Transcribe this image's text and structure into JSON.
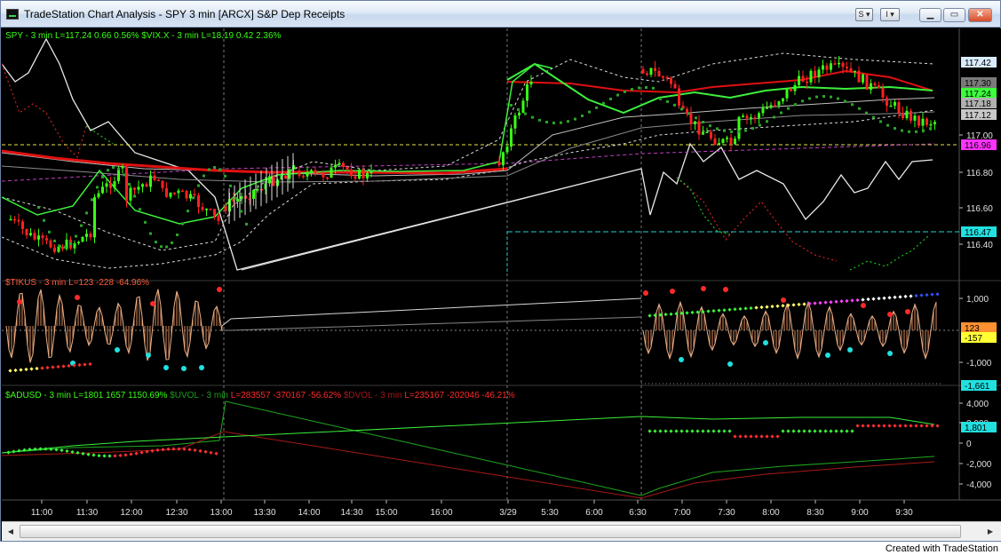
{
  "window": {
    "title": "TradeStation Chart Analysis - SPY 3 min [ARCX] S&P Dep Receipts",
    "toolbar": {
      "btn_s": "S",
      "btn_i": "I"
    },
    "footer": "Created with TradeStation"
  },
  "panes": {
    "price": {
      "legend": [
        {
          "text": "SPY - 3 min",
          "color": "#39ff14"
        },
        {
          "text": "L=117.24",
          "color": "#39ff14"
        },
        {
          "text": "0.66",
          "color": "#39ff14"
        },
        {
          "text": "0.56%",
          "color": "#39ff14"
        },
        {
          "text": "$VIX.X - 3 min",
          "color": "#39ff14"
        },
        {
          "text": "L=18.19",
          "color": "#39ff14"
        },
        {
          "text": "0.42",
          "color": "#39ff14"
        },
        {
          "text": "2.36%",
          "color": "#39ff14"
        }
      ],
      "axis_ticks": [
        "117.00",
        "116.80",
        "116.60",
        "116.40"
      ],
      "axis_tags": [
        {
          "text": "117.42",
          "bg": "#d9ecff",
          "fg": "#000000"
        },
        {
          "text": "117.30",
          "bg": "#7a7a7a",
          "fg": "#000000"
        },
        {
          "text": "117.24",
          "bg": "#3cff3c",
          "fg": "#000000"
        },
        {
          "text": "117.18",
          "bg": "#b0b0b0",
          "fg": "#000000"
        },
        {
          "text": "117.12",
          "bg": "#c8c8c8",
          "fg": "#000000"
        },
        {
          "text": "116.96",
          "bg": "#ff33ff",
          "fg": "#000000"
        },
        {
          "text": "116.47",
          "bg": "#22e0e0",
          "fg": "#000000"
        }
      ]
    },
    "tikus": {
      "legend": [
        {
          "text": "$TIKUS - 3 min",
          "color": "#ff5a3a"
        },
        {
          "text": "L=123",
          "color": "#ff5a3a"
        },
        {
          "text": "-228",
          "color": "#ff5a3a"
        },
        {
          "text": "-64.96%",
          "color": "#ff5a3a"
        }
      ],
      "axis_ticks": [
        "1,000",
        "-1,000"
      ],
      "axis_tags": [
        {
          "text": "123",
          "bg": "#ff9030",
          "fg": "#000000"
        },
        {
          "text": "-157",
          "bg": "#ffff33",
          "fg": "#000000"
        },
        {
          "text": "-1,661",
          "bg": "#22e0e0",
          "fg": "#000000"
        }
      ]
    },
    "adusd": {
      "legend": [
        {
          "text": "$ADUSD - 3 min",
          "color": "#39ff14"
        },
        {
          "text": "L=1801",
          "color": "#39ff14"
        },
        {
          "text": "1657",
          "color": "#39ff14"
        },
        {
          "text": "1150.69%",
          "color": "#39ff14"
        },
        {
          "text": "$UVOL - 3 min",
          "color": "#1f9c1f"
        },
        {
          "text": "L=283557",
          "color": "#ff2a2a"
        },
        {
          "text": "-370167",
          "color": "#ff2a2a"
        },
        {
          "text": "-56.62%",
          "color": "#ff2a2a"
        },
        {
          "text": "$DVOL - 3 min",
          "color": "#a01818"
        },
        {
          "text": "L=235167",
          "color": "#ff2a2a"
        },
        {
          "text": "-202046",
          "color": "#ff2a2a"
        },
        {
          "text": "-46.21%",
          "color": "#ff2a2a"
        }
      ],
      "axis_ticks": [
        "4,000",
        "2,000",
        "0",
        "-2,000",
        "-4,000"
      ],
      "axis_tags": [
        {
          "text": "1,801",
          "bg": "#22e0e0",
          "fg": "#000000"
        }
      ]
    }
  },
  "time_axis": [
    "11:00",
    "11:30",
    "12:00",
    "12:30",
    "13:00",
    "13:30",
    "14:00",
    "14:30",
    "15:00",
    "16:00",
    "3/29",
    "5:30",
    "6:00",
    "6:30",
    "7:00",
    "7:30",
    "8:00",
    "8:30",
    "9:00",
    "9:30"
  ],
  "colors": {
    "up": "#39ff14",
    "down": "#ff2020",
    "background": "#000000"
  }
}
